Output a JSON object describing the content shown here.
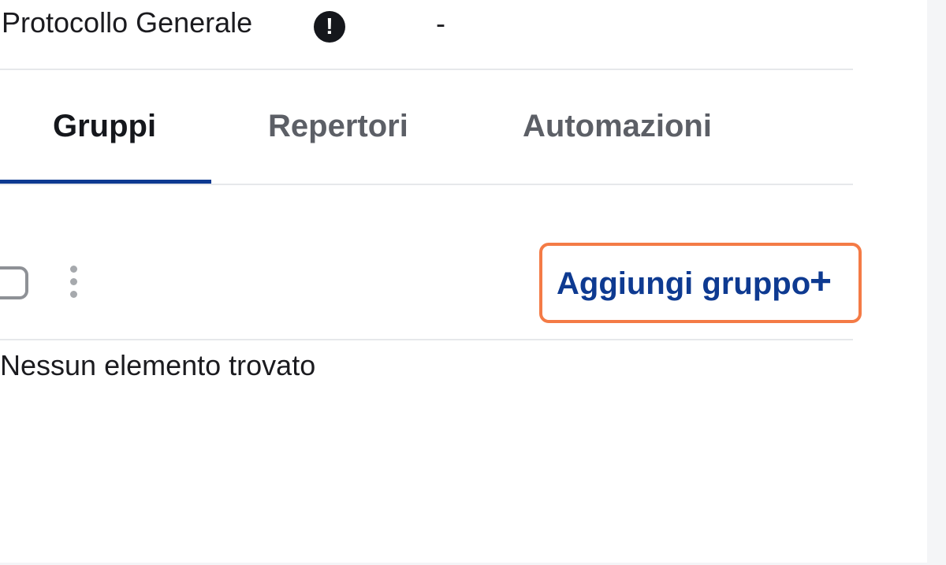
{
  "header": {
    "title": "Protocollo Generale",
    "alert_icon": "exclamation-circle-icon",
    "alert_symbol": "!",
    "value": "-"
  },
  "tabs": [
    {
      "label": "Gruppi",
      "active": true
    },
    {
      "label": "Repertori",
      "active": false
    },
    {
      "label": "Automazioni",
      "active": false
    }
  ],
  "toolbar": {
    "select_all_icon": "checkbox-icon",
    "more_actions_icon": "kebab-menu-icon",
    "add_button_label": "Aggiungi gruppo",
    "add_icon": "plus-icon",
    "add_symbol": "+"
  },
  "list": {
    "empty_message": "Nessun elemento trovato"
  },
  "colors": {
    "accent": "#0e3a91",
    "highlight": "#f47b46",
    "text": "#1b1b1f",
    "muted_text": "#5c5f66",
    "divider": "#e6e8eb"
  }
}
